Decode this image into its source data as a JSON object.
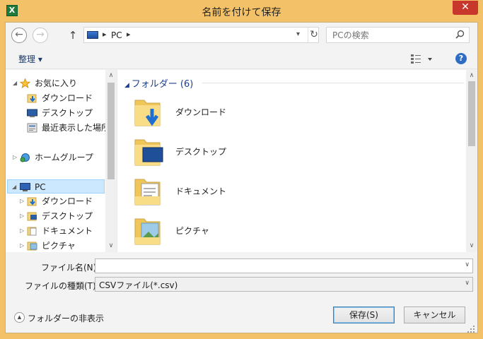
{
  "window": {
    "title": "名前を付けて保存",
    "app_icon_letter": "X",
    "close_glyph": "✕"
  },
  "address_bar": {
    "breadcrumb": "PC",
    "search_placeholder": "PCの検索"
  },
  "toolbar": {
    "organize_label": "整理 ▾"
  },
  "nav_pane": {
    "favorites": {
      "label": "お気に入り",
      "items": [
        "ダウンロード",
        "デスクトップ",
        "最近表示した場所"
      ]
    },
    "homegroup": {
      "label": "ホームグループ"
    },
    "pc": {
      "label": "PC",
      "items": [
        "ダウンロード",
        "デスクトップ",
        "ドキュメント",
        "ピクチャ"
      ]
    }
  },
  "content": {
    "group_header": "フォルダー (6)",
    "folders": [
      {
        "name": "ダウンロード",
        "icon": "download-folder-icon"
      },
      {
        "name": "デスクトップ",
        "icon": "desktop-folder-icon"
      },
      {
        "name": "ドキュメント",
        "icon": "documents-folder-icon"
      },
      {
        "name": "ピクチャ",
        "icon": "pictures-folder-icon"
      }
    ]
  },
  "form": {
    "filename_label": "ファイル名(N):",
    "filename_value": "",
    "filetype_label": "ファイルの種類(T):",
    "filetype_value": "CSVファイル(*.csv)"
  },
  "footer": {
    "hide_folders_label": "フォルダーの非表示",
    "save_button": "保存(S)",
    "cancel_button": "キャンセル"
  },
  "colors": {
    "frame": "#f3c168",
    "close": "#c7372b",
    "selection": "#cce8ff",
    "group_header": "#1e3f8c"
  }
}
